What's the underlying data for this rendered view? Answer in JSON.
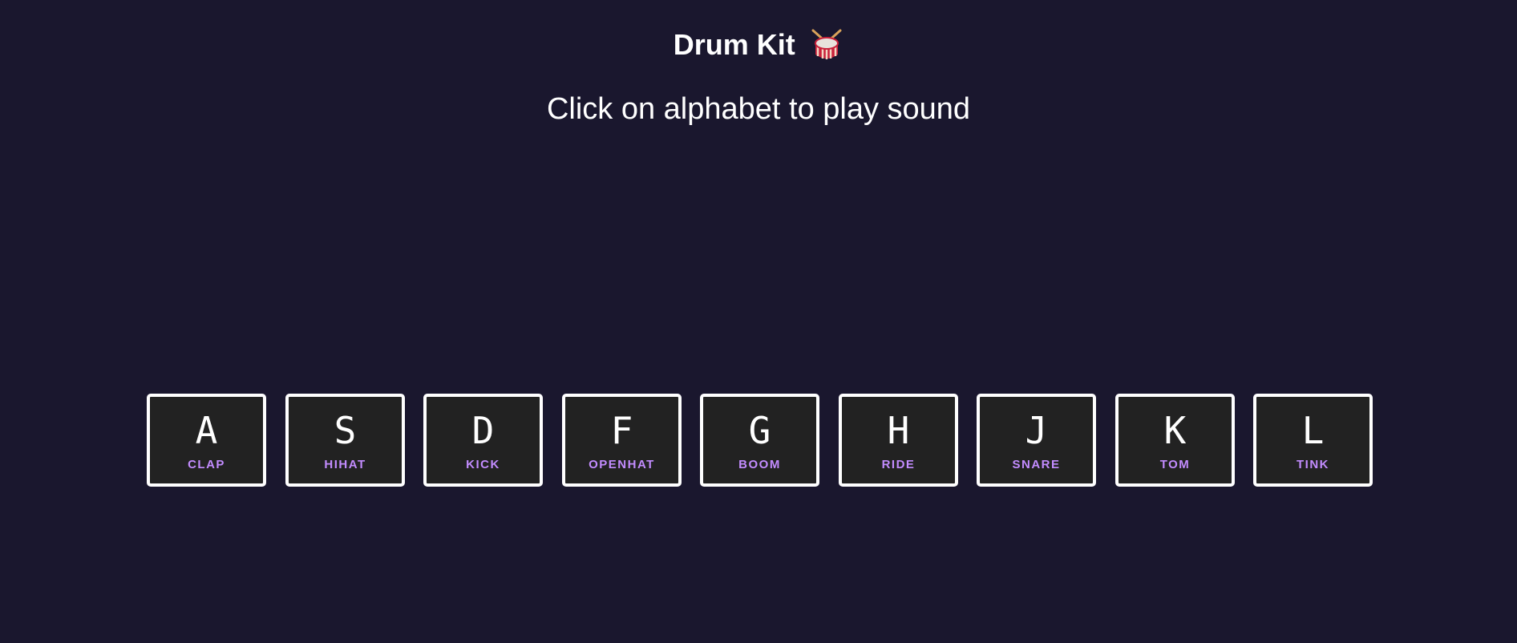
{
  "header": {
    "title": "Drum Kit",
    "title_icon": "drum-icon",
    "subtitle": "Click on alphabet to play sound"
  },
  "colors": {
    "background": "#1a172e",
    "key_background": "#222222",
    "key_border": "#ffffff",
    "key_letter": "#ffffff",
    "sound_label": "#c38cff"
  },
  "keys": [
    {
      "letter": "A",
      "sound": "CLAP"
    },
    {
      "letter": "S",
      "sound": "HIHAT"
    },
    {
      "letter": "D",
      "sound": "KICK"
    },
    {
      "letter": "F",
      "sound": "OPENHAT"
    },
    {
      "letter": "G",
      "sound": "BOOM"
    },
    {
      "letter": "H",
      "sound": "RIDE"
    },
    {
      "letter": "J",
      "sound": "SNARE"
    },
    {
      "letter": "K",
      "sound": "TOM"
    },
    {
      "letter": "L",
      "sound": "TINK"
    }
  ]
}
